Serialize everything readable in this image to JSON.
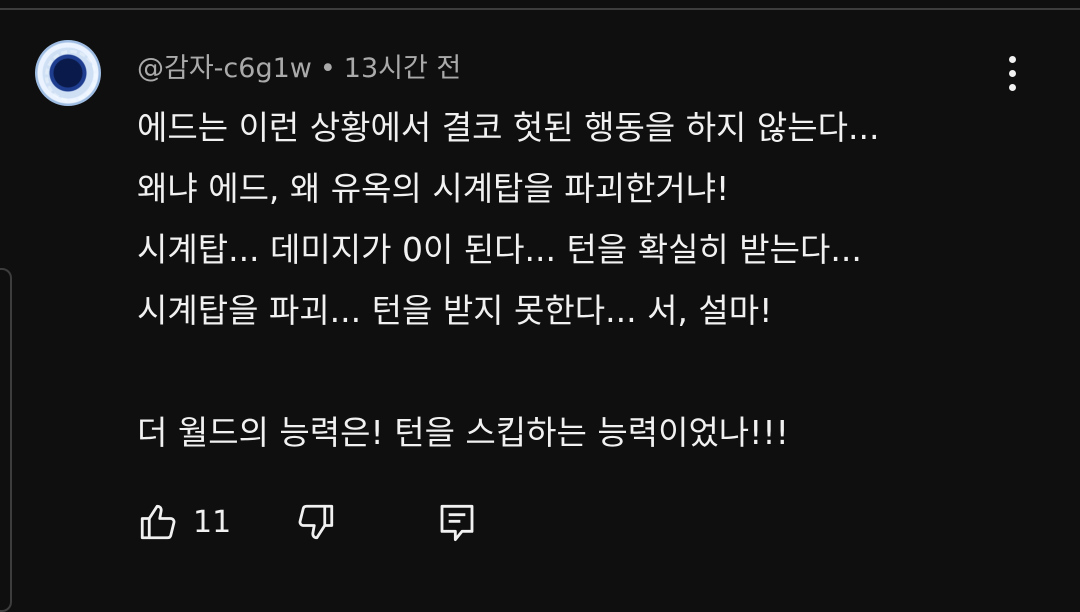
{
  "comment": {
    "author": "@감자-c6g1w",
    "separator": "•",
    "time": "13시간 전",
    "lines": [
      "에드는 이런 상황에서 결코 헛된 행동을 하지 않는다...",
      "왜냐 에드, 왜 유옥의 시계탑을 파괴한거냐!",
      "시계탑... 데미지가 0이 된다... 턴을 확실히 받는다...",
      "시계탑을 파괴... 턴을 받지 못한다... 서, 설마!",
      "",
      "더 월드의 능력은! 턴을 스킵하는 능력이었나!!!"
    ],
    "like_count": "11"
  },
  "icons": {
    "like": "thumbs-up-icon",
    "dislike": "thumbs-down-icon",
    "reply": "reply-comment-icon",
    "menu": "more-vertical-icon"
  },
  "colors": {
    "background": "#0f0f0f",
    "text": "#f1f1f1",
    "meta": "#aaaaaa"
  }
}
